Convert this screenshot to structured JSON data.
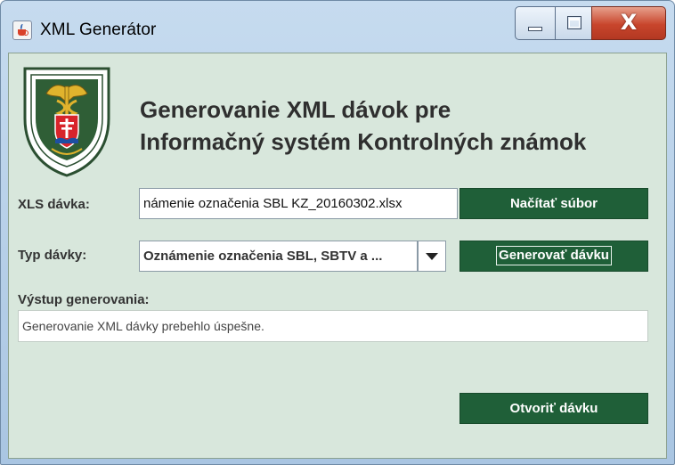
{
  "window": {
    "title": "XML Generátor",
    "close_glyph": "X"
  },
  "emblem": {
    "alt": "Finančná správa Slovenská republika"
  },
  "header": {
    "line1": "Generovanie XML dávok pre",
    "line2": "Informačný systém Kontrolných známok"
  },
  "form": {
    "xls_label": "XLS dávka:",
    "xls_value": "námenie označenia SBL KZ_20160302.xlsx",
    "load_button": "Načítať súbor",
    "type_label": "Typ dávky:",
    "type_value": "Oznámenie označenia SBL, SBTV a ...",
    "generate_button": "Generovať dávku",
    "output_label": "Výstup generovania:",
    "output_value": "Generovanie XML dávky prebehlo úspešne.",
    "open_button": "Otvoriť dávku"
  },
  "colors": {
    "panel_background": "#d8e7dc",
    "button_background": "#1f5f38",
    "title_bar": "#b9d1ea",
    "close_button": "#c8452c"
  },
  "icons": {
    "app": "java-cup-icon",
    "minimize": "minimize-icon",
    "maximize": "maximize-icon",
    "close": "close-icon",
    "dropdown": "chevron-down-icon",
    "emblem": "financial-administration-emblem"
  }
}
